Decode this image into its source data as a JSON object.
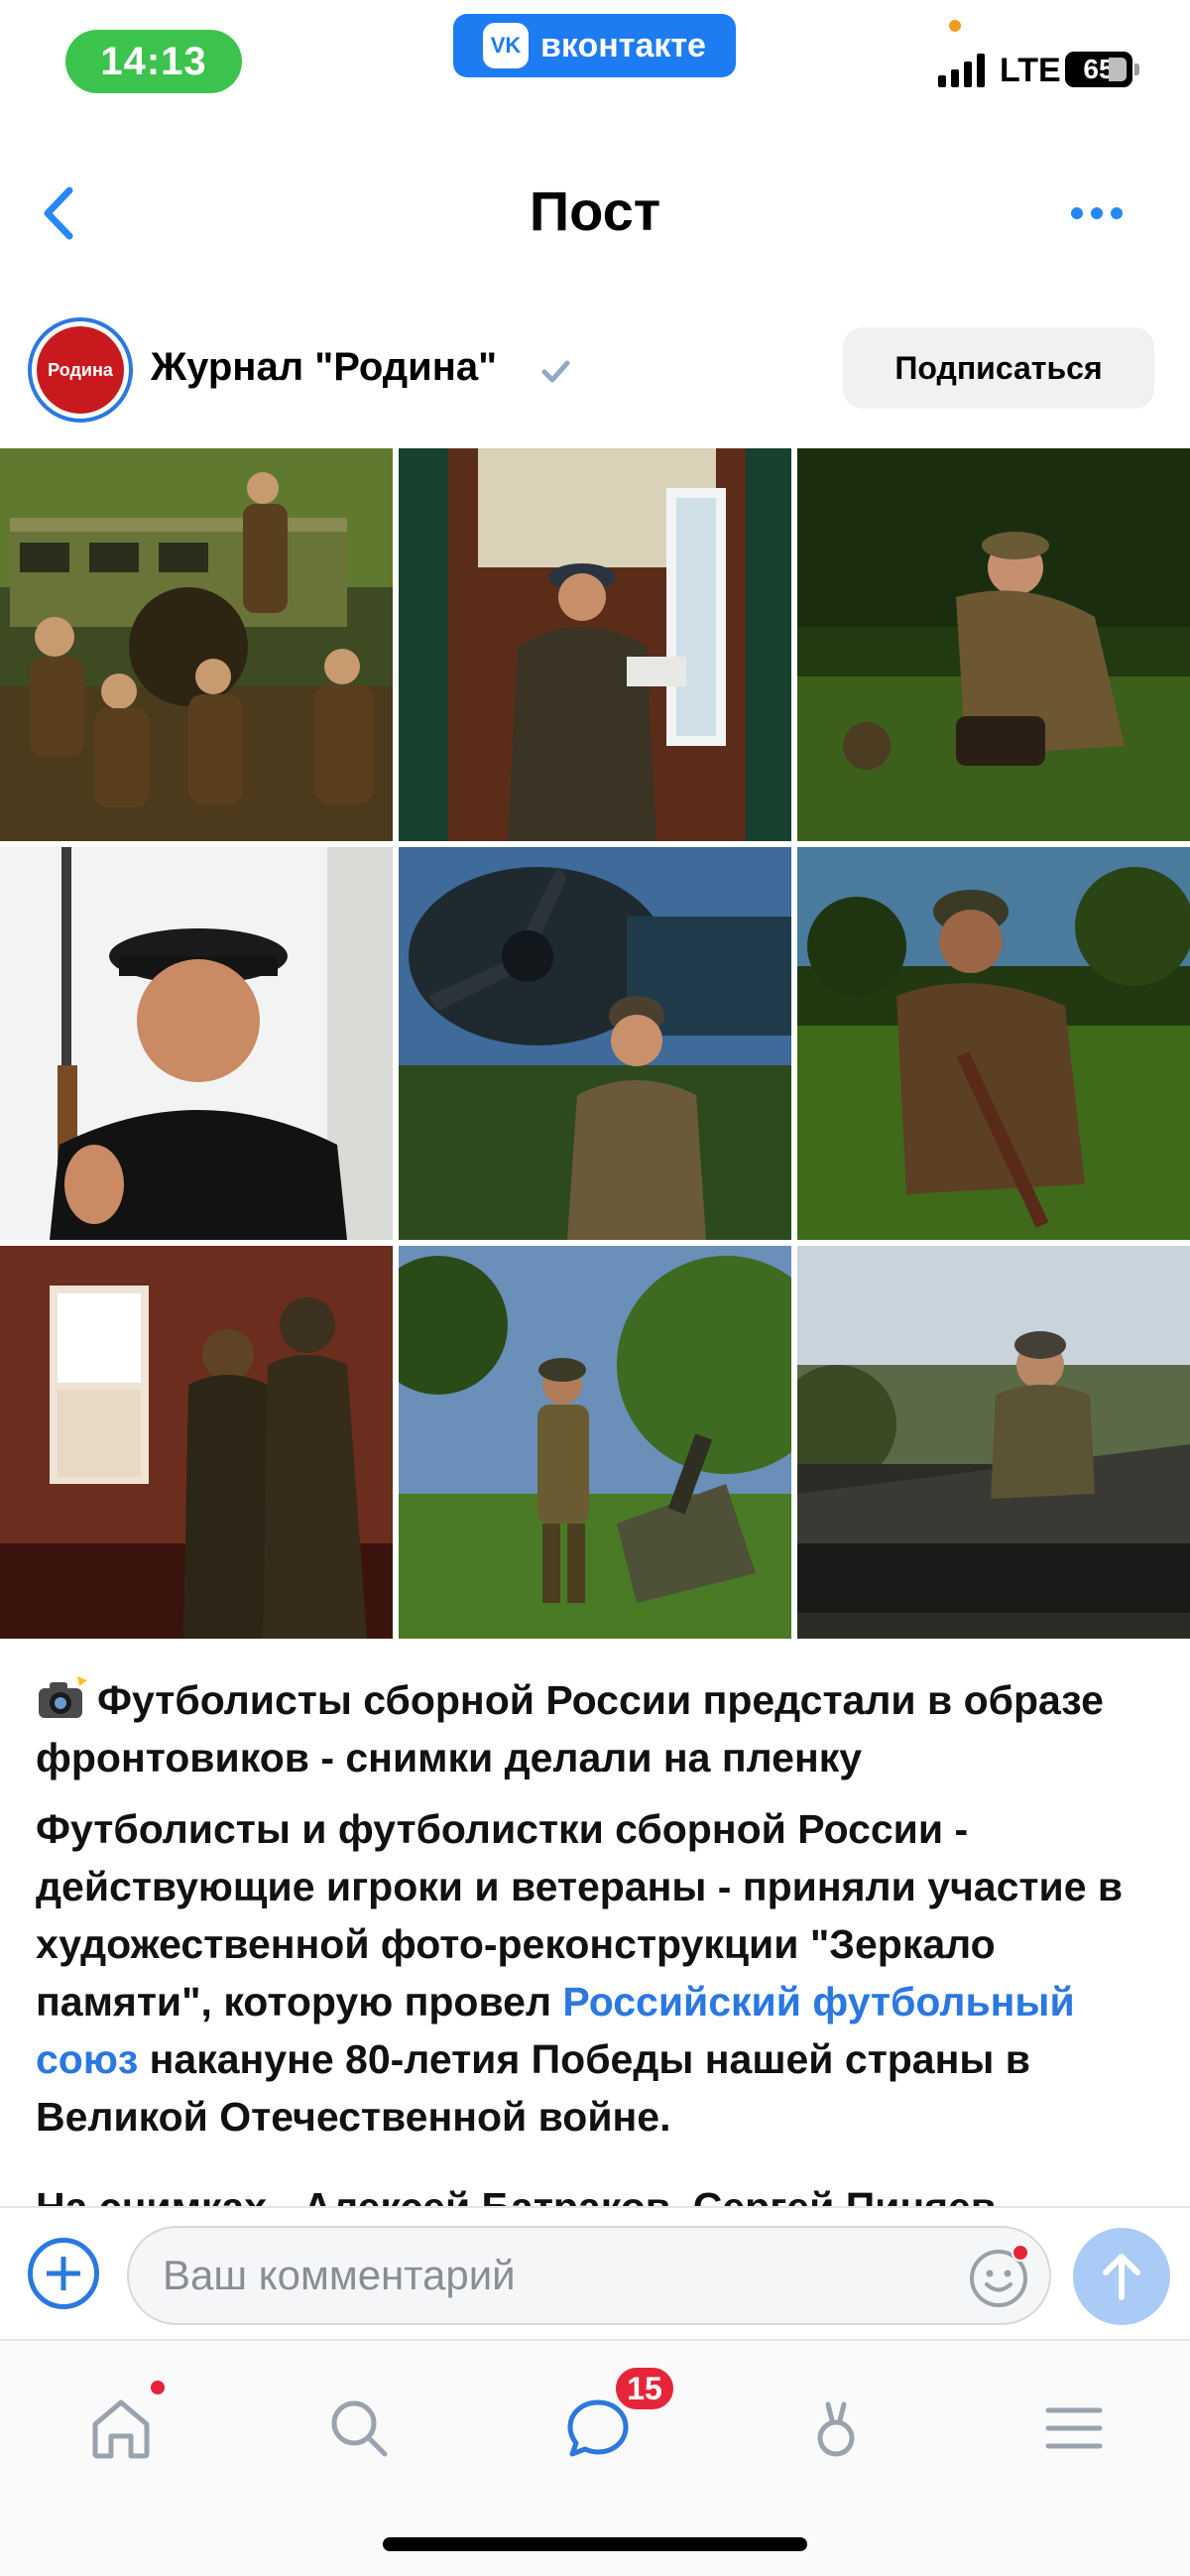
{
  "status_bar": {
    "time": "14:13",
    "app_badge": "вконтакте",
    "app_logo": "VK",
    "network": "LTE",
    "battery": "65"
  },
  "header": {
    "title": "Пост",
    "back_icon": "chevron-left-icon",
    "more_icon": "ellipsis-icon"
  },
  "author": {
    "name": "Журнал \"Родина\"",
    "avatar_text": "Родина",
    "verified": true,
    "subscribe_label": "Подписаться"
  },
  "photos": [
    {
      "id": "photo-1",
      "scene": "soldiers-by-train-car"
    },
    {
      "id": "photo-2",
      "scene": "officer-in-train-corridor"
    },
    {
      "id": "photo-3",
      "scene": "soldier-with-field-telephone"
    },
    {
      "id": "photo-4",
      "scene": "sailor-with-rifle"
    },
    {
      "id": "photo-5",
      "scene": "pilot-by-aircraft-propeller"
    },
    {
      "id": "photo-6",
      "scene": "woman-soldier-with-rifle"
    },
    {
      "id": "photo-7",
      "scene": "soldiers-at-window"
    },
    {
      "id": "photo-8",
      "scene": "soldier-by-artillery-gun"
    },
    {
      "id": "photo-9",
      "scene": "soldier-on-tank"
    }
  ],
  "post": {
    "headline": "Футболисты сборной России предстали в образе фронтовиков - снимки делали на пленку",
    "body_part1": "Футболисты и футболистки сборной России - действующие игроки и ветераны - приняли участие в художественной фото-реконструкции \"Зеркало памяти\", которую провел ",
    "body_link": "Российский футбольный союз",
    "body_part2": " накануне 80-летия Победы нашей страны в Великой Отечественной войне.",
    "cut_line": "На снимках - Алексей Батраков, Сергей Пиняев,"
  },
  "comment": {
    "placeholder": "Ваш комментарий"
  },
  "tabs": {
    "messages_badge": "15",
    "items": [
      "home-icon",
      "search-icon",
      "messages-icon",
      "clips-icon",
      "menu-icon"
    ]
  },
  "colors": {
    "accent": "#2a78e0",
    "status_green": "#3cc34d",
    "badge_red": "#e6253a"
  }
}
